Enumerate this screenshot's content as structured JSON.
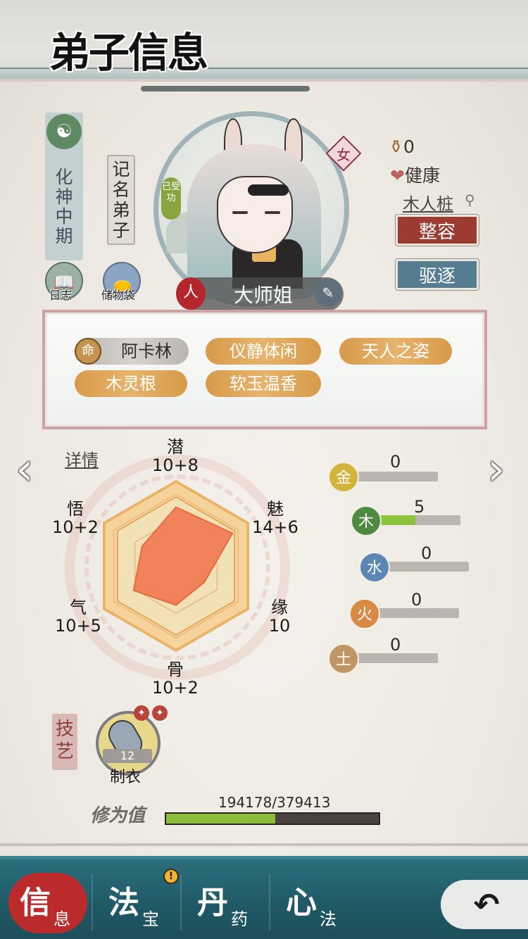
{
  "header": {
    "title": "弟子信息"
  },
  "disciple": {
    "realm": "化神中期",
    "role": "记名弟子",
    "moved_badge": "已受功",
    "gender": "女",
    "name": "大师姐",
    "race_icon": "人",
    "coin_value": "0",
    "health": "健康",
    "practice_location": "木人桩"
  },
  "shortcuts": {
    "log_label": "日志",
    "bag_label": "储物袋"
  },
  "actions": {
    "makeover_label": "整容",
    "expel_label": "驱逐"
  },
  "traits": [
    {
      "label": "阿卡林",
      "icon": "命"
    },
    {
      "label": "仪静体闲"
    },
    {
      "label": "天人之姿"
    },
    {
      "label": "木灵根"
    },
    {
      "label": "软玉温香"
    }
  ],
  "attributes": {
    "details_link": "详情",
    "stats": [
      {
        "name": "潜",
        "value": "10+8"
      },
      {
        "name": "魅",
        "value": "14+6"
      },
      {
        "name": "缘",
        "value": "10"
      },
      {
        "name": "骨",
        "value": "10+2"
      },
      {
        "name": "气",
        "value": "10+5"
      },
      {
        "name": "悟",
        "value": "10+2"
      }
    ]
  },
  "elements": [
    {
      "name": "金",
      "value": "0",
      "fill": 0,
      "color": "#d4b33a"
    },
    {
      "name": "木",
      "value": "5",
      "fill": 0.5,
      "color": "#4f8a43"
    },
    {
      "name": "水",
      "value": "0",
      "fill": 0,
      "color": "#5c86b3"
    },
    {
      "name": "火",
      "value": "0",
      "fill": 0,
      "color": "#d88a45"
    },
    {
      "name": "土",
      "value": "0",
      "fill": 0,
      "color": "#c29564"
    }
  ],
  "skills": {
    "tag": "技艺",
    "items": [
      {
        "name": "制衣",
        "level": "12"
      }
    ]
  },
  "cultivation": {
    "label": "修为值",
    "value_text": "194178/379413",
    "progress": 0.5118
  },
  "tabs": [
    {
      "main": "信",
      "sub": "息",
      "active": true
    },
    {
      "main": "法",
      "sub": "宝",
      "alert": "!"
    },
    {
      "main": "丹",
      "sub": "药"
    },
    {
      "main": "心",
      "sub": "法"
    }
  ],
  "back_icon": "back-arrow-icon",
  "colors": {
    "tab_bar": "#1f5865",
    "tab_active": "#bb2b2c",
    "makeover": "#9c3b32",
    "expel": "#557c90",
    "trait": "#e0a758",
    "radar_fill": "#f2825a"
  }
}
